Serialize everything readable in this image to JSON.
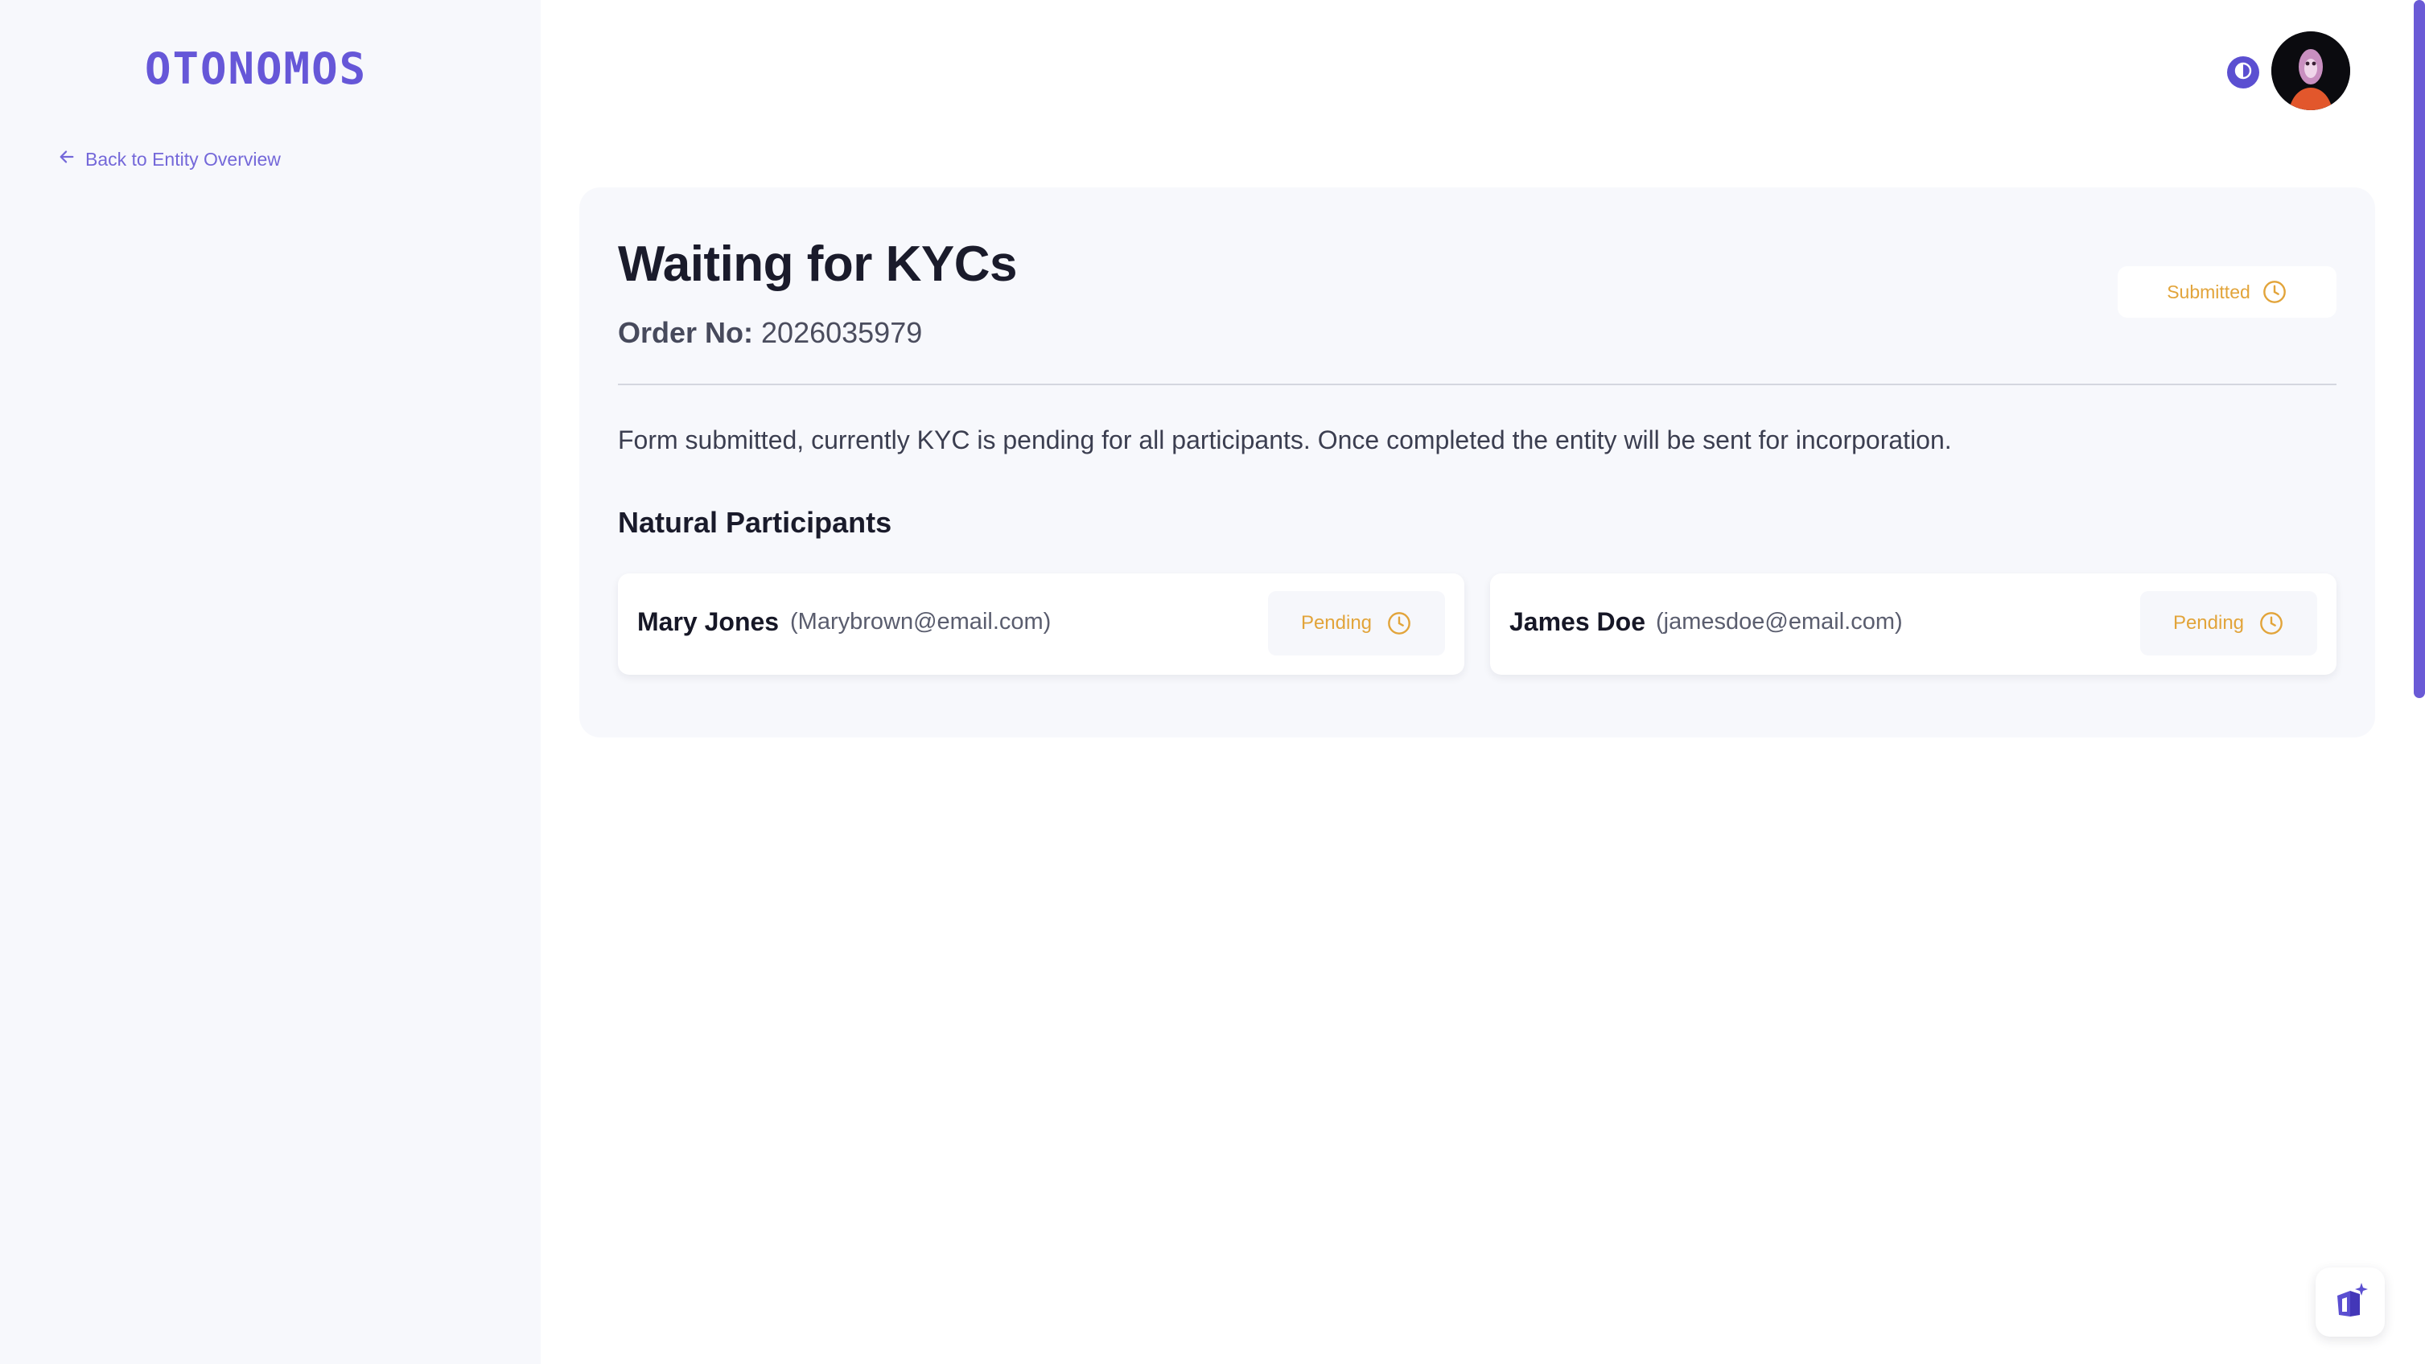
{
  "brand": {
    "logo_text": "OTONOMOS",
    "color": "#6657d8"
  },
  "nav": {
    "back_label": "Back to Entity Overview",
    "back_icon": "arrow-left-icon"
  },
  "header": {
    "theme_toggle_icon": "half-circle-contrast-icon",
    "avatar_icon": "user-avatar"
  },
  "order": {
    "title": "Waiting for KYCs",
    "order_no_label": "Order No:",
    "order_no_value": "2026035979",
    "status": "Submitted",
    "status_icon": "clock-icon",
    "status_color": "#e2a43a",
    "description": "Form submitted, currently KYC is pending for all participants. Once completed the entity will be sent for incorporation."
  },
  "participants": {
    "section_title": "Natural Participants",
    "items": [
      {
        "name": "Mary Jones",
        "email": "(Marybrown@email.com)",
        "status": "Pending"
      },
      {
        "name": "James Doe",
        "email": "(jamesdoe@email.com)",
        "status": "Pending"
      }
    ]
  },
  "fab": {
    "icon": "ai-assistant-sparkle-icon"
  }
}
